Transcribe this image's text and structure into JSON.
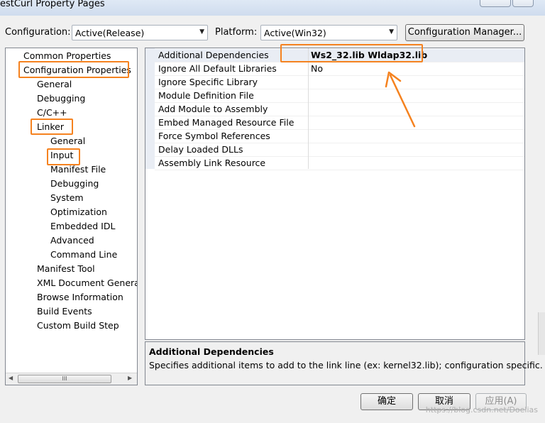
{
  "window": {
    "title": "estCurl Property Pages"
  },
  "toolbar": {
    "configuration_label": "Configuration:",
    "configuration_value": "Active(Release)",
    "platform_label": "Platform:",
    "platform_value": "Active(Win32)",
    "config_manager_label": "Configuration Manager..."
  },
  "tree": {
    "items": [
      {
        "label": "Common Properties"
      },
      {
        "label": "Configuration Properties"
      },
      {
        "label": "General"
      },
      {
        "label": "Debugging"
      },
      {
        "label": "C/C++"
      },
      {
        "label": "Linker"
      },
      {
        "label": "General"
      },
      {
        "label": "Input"
      },
      {
        "label": "Manifest File"
      },
      {
        "label": "Debugging"
      },
      {
        "label": "System"
      },
      {
        "label": "Optimization"
      },
      {
        "label": "Embedded IDL"
      },
      {
        "label": "Advanced"
      },
      {
        "label": "Command Line"
      },
      {
        "label": "Manifest Tool"
      },
      {
        "label": "XML Document Generat"
      },
      {
        "label": "Browse Information"
      },
      {
        "label": "Build Events"
      },
      {
        "label": "Custom Build Step"
      }
    ],
    "scroll_left": "◀",
    "scroll_right": "▶",
    "scroll_grip": "III"
  },
  "grid": {
    "rows": [
      {
        "name": "Additional Dependencies",
        "value": "Ws2_32.lib Wldap32.lib"
      },
      {
        "name": "Ignore All Default Libraries",
        "value": "No"
      },
      {
        "name": "Ignore Specific Library",
        "value": ""
      },
      {
        "name": "Module Definition File",
        "value": ""
      },
      {
        "name": "Add Module to Assembly",
        "value": ""
      },
      {
        "name": "Embed Managed Resource File",
        "value": ""
      },
      {
        "name": "Force Symbol References",
        "value": ""
      },
      {
        "name": "Delay Loaded DLLs",
        "value": ""
      },
      {
        "name": "Assembly Link Resource",
        "value": ""
      }
    ]
  },
  "description": {
    "title": "Additional Dependencies",
    "text": "Specifies additional items to add to the link line (ex: kernel32.lib); configuration specific."
  },
  "buttons": {
    "ok": "确定",
    "cancel": "取消",
    "apply": "应用(A)"
  },
  "watermark": "https://blog.csdn.net/Doelias",
  "colors": {
    "highlight": "#f5821f",
    "background": "#f0f0f0"
  }
}
